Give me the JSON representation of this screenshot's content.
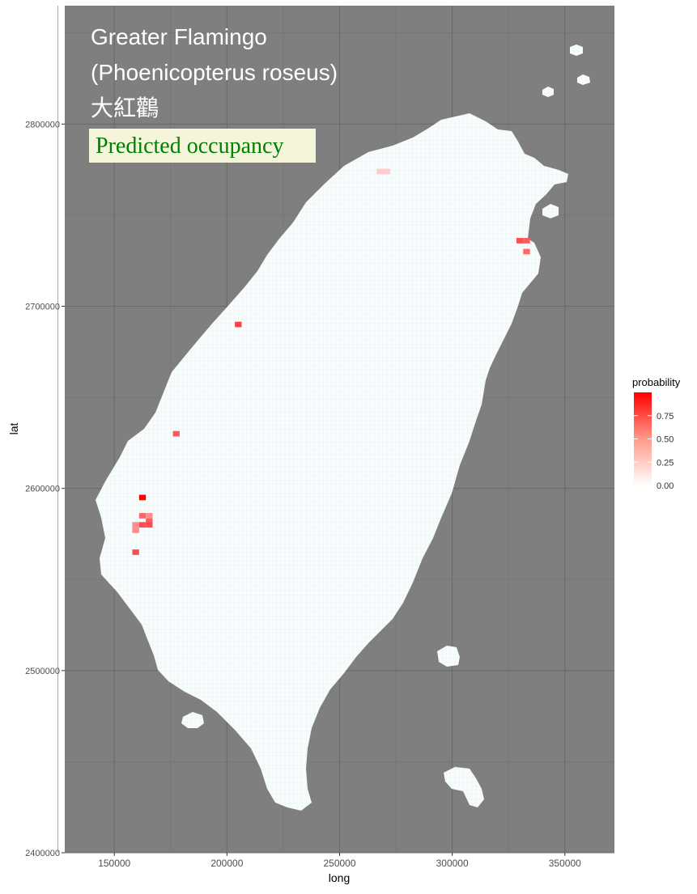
{
  "chart_data": {
    "type": "heatmap",
    "title_lines": [
      "Greater Flamingo",
      "(Phoenicopterus roseus)",
      "大紅鸛"
    ],
    "subtitle": "Predicted occupancy",
    "xlabel": "long",
    "ylabel": "lat",
    "xlim": [
      128000,
      372000
    ],
    "ylim": [
      2400000,
      2865000
    ],
    "x_ticks": [
      150000,
      200000,
      250000,
      300000,
      350000
    ],
    "y_ticks": [
      2400000,
      2500000,
      2600000,
      2700000,
      2800000
    ],
    "x_tick_labels": [
      "150000",
      "200000",
      "250000",
      "300000",
      "350000"
    ],
    "y_tick_labels": [
      "2400000",
      "2500000",
      "2600000",
      "2700000",
      "2800000"
    ],
    "grid": true,
    "legend": {
      "title": "probability",
      "position": "right",
      "min": 0,
      "max": 1,
      "ticks": [
        0.0,
        0.25,
        0.5,
        0.75
      ],
      "tick_labels": [
        "0.00",
        "0.25",
        "0.50",
        "0.75"
      ],
      "color_low": "#ffffff",
      "color_high": "#ff0000"
    },
    "colors": {
      "panel_background": "#7f7f7f",
      "land": "#f7fcfc",
      "title_text": "#ffffff",
      "subtitle_text": "#008000",
      "subtitle_box": "#f5f5dc"
    },
    "cells": [
      {
        "x": 162500,
        "y": 2595000,
        "p": 1.0
      },
      {
        "x": 162500,
        "y": 2585000,
        "p": 0.6
      },
      {
        "x": 165500,
        "y": 2585000,
        "p": 0.45
      },
      {
        "x": 165500,
        "y": 2582000,
        "p": 0.65
      },
      {
        "x": 162500,
        "y": 2580000,
        "p": 0.7
      },
      {
        "x": 165500,
        "y": 2580000,
        "p": 0.7
      },
      {
        "x": 159500,
        "y": 2580000,
        "p": 0.45
      },
      {
        "x": 159500,
        "y": 2577000,
        "p": 0.45
      },
      {
        "x": 159500,
        "y": 2565000,
        "p": 0.7
      },
      {
        "x": 177500,
        "y": 2630000,
        "p": 0.65
      },
      {
        "x": 205000,
        "y": 2690000,
        "p": 0.75
      },
      {
        "x": 268000,
        "y": 2774000,
        "p": 0.2
      },
      {
        "x": 271000,
        "y": 2774000,
        "p": 0.2
      },
      {
        "x": 330000,
        "y": 2736000,
        "p": 0.7
      },
      {
        "x": 333000,
        "y": 2736000,
        "p": 0.65
      },
      {
        "x": 333000,
        "y": 2730000,
        "p": 0.6
      }
    ]
  }
}
